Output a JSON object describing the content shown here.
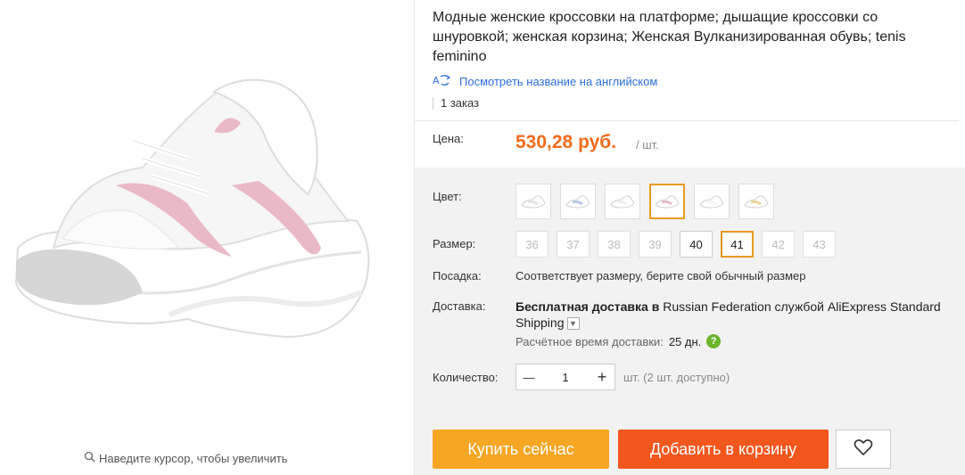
{
  "product": {
    "title": "Модные женские кроссовки на платформе; дышащие кроссовки со шнуровкой; женская корзина; Женская Вулканизированная обувь; tenis feminino",
    "translate_link": "Посмотреть название на английском",
    "orders": "1 заказ",
    "zoom_hint": "Наведите курсор, чтобы увеличить"
  },
  "price": {
    "label": "Цена:",
    "value": "530,28 руб.",
    "unit": "/ шт.",
    "color": "#f06b1b"
  },
  "color": {
    "label": "Цвет:",
    "selected_index": 3,
    "swatch_count": 6,
    "accent": "#e89a1e"
  },
  "size": {
    "label": "Размер:",
    "options": [
      "36",
      "37",
      "38",
      "39",
      "40",
      "41",
      "42",
      "43"
    ],
    "available": [
      "40",
      "41"
    ],
    "selected": "41"
  },
  "fit": {
    "label": "Посадка:",
    "text": "Соответствует размеру, берите свой обычный размер"
  },
  "delivery": {
    "label": "Доставка:",
    "bold_prefix": "Бесплатная доставка в",
    "rest": " Russian Federation службой AliExpress Standard Shipping",
    "eta_label": "Расчётное время доставки:",
    "eta_value": "25 дн.",
    "help_icon": "?"
  },
  "quantity": {
    "label": "Количество:",
    "minus": "—",
    "value": "1",
    "plus": "+",
    "available": "шт. (2 шт. доступно)"
  },
  "actions": {
    "buy_now": "Купить сейчас",
    "add_to_cart": "Добавить в корзину",
    "wishlist_icon": "heart-icon",
    "buy_color": "#f5a623",
    "cart_color": "#f2571e"
  }
}
